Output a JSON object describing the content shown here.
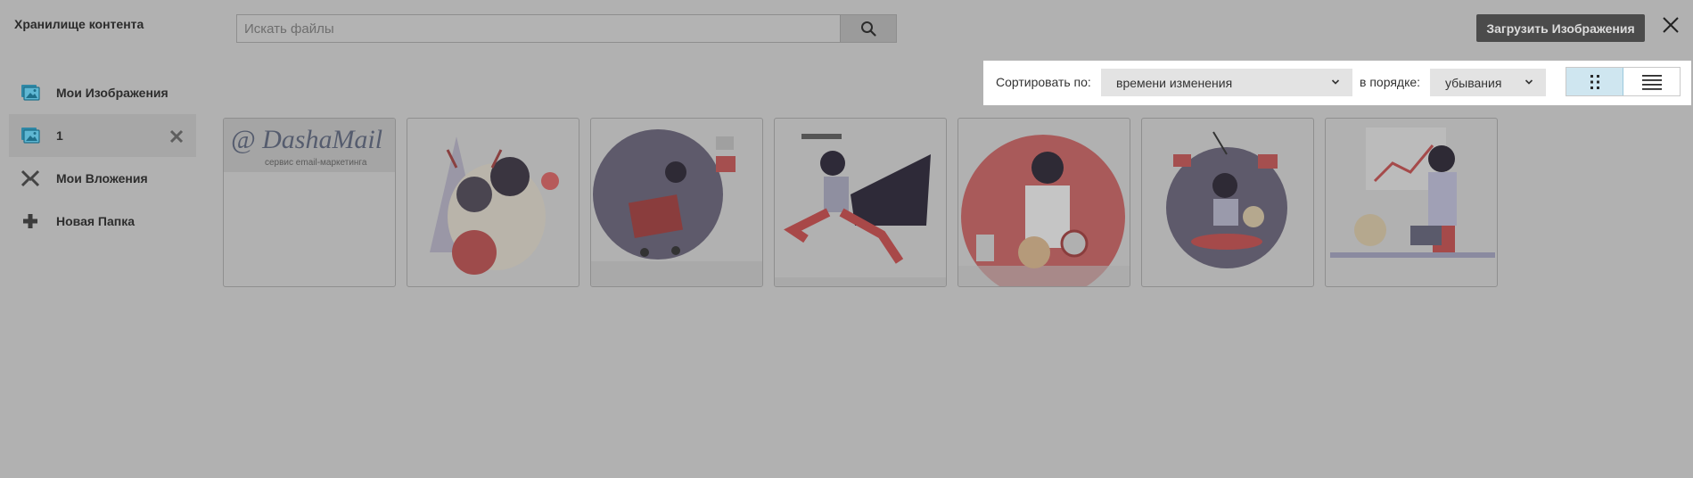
{
  "header": {
    "title": "Хранилище контента",
    "search_placeholder": "Искать файлы",
    "upload_label": "Загрузить Изображения"
  },
  "sidebar": {
    "items": [
      {
        "label": "Мои Изображения",
        "icon": "images-folder-icon"
      },
      {
        "label": "1",
        "icon": "images-folder-icon",
        "active": true
      },
      {
        "label": "Мои Вложения",
        "icon": "attachments-icon"
      },
      {
        "label": "Новая Папка",
        "icon": "plus-icon"
      }
    ]
  },
  "toolbar": {
    "sort_label": "Сортировать по:",
    "sort_value": "времени изменения",
    "order_label": "в порядке:",
    "order_value": "убывания",
    "view_modes": [
      "grid",
      "list"
    ],
    "active_view": "grid"
  },
  "gallery": {
    "items": [
      {
        "kind": "logo",
        "logo_text": "@ DashaMail",
        "tagline": "сервис email-маркетинга"
      },
      {
        "kind": "illustration",
        "subject": "woman with dog in reindeer antlers"
      },
      {
        "kind": "illustration",
        "subject": "woman with dog in shopping cart"
      },
      {
        "kind": "illustration",
        "subject": "woman with wrench and cape"
      },
      {
        "kind": "illustration",
        "subject": "woman scientist with flasks"
      },
      {
        "kind": "illustration",
        "subject": "woman meditating with dog"
      },
      {
        "kind": "illustration",
        "subject": "woman at laptop with dog and chart"
      }
    ]
  },
  "colors": {
    "overlay": "#b1b1b1",
    "toolbar_bg": "#ffffff",
    "upload_bg": "#4b4b4b",
    "accent_teal": "#1f8fb0",
    "active_view_bg": "#cfe6f0"
  }
}
